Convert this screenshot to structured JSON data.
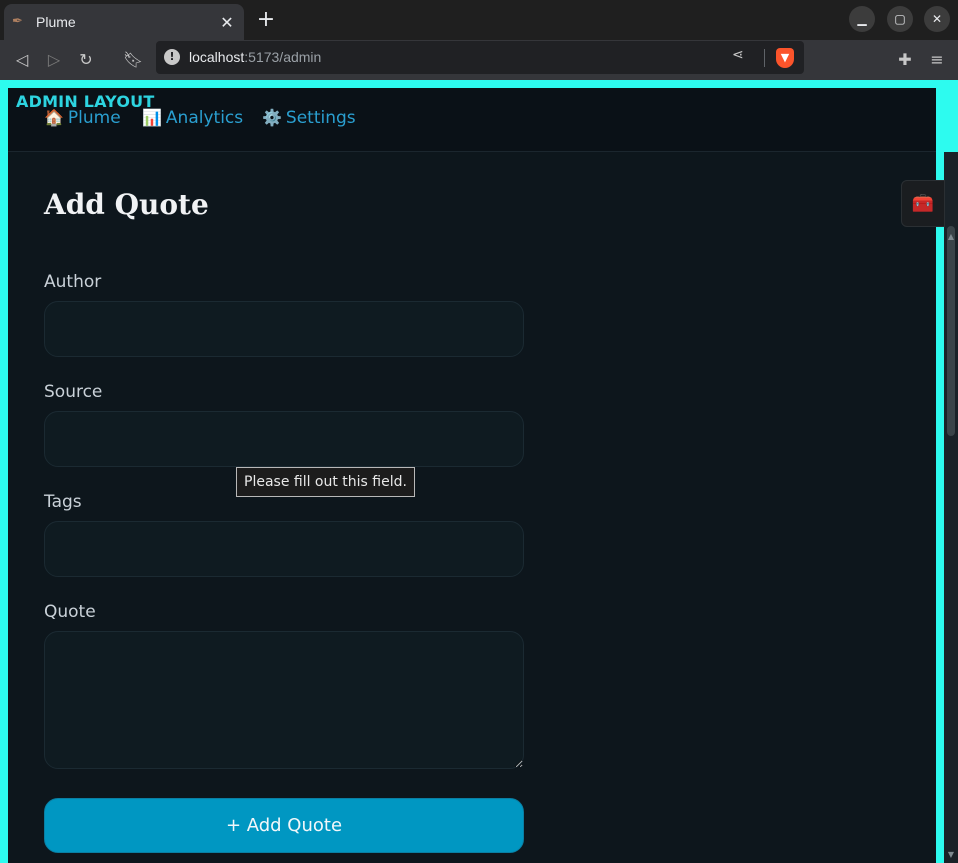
{
  "browser": {
    "tab_title": "Plume",
    "tab_favicon": "feather-icon",
    "new_tab_glyph": "+",
    "url_host": "localhost",
    "url_rest": ":5173/admin"
  },
  "app": {
    "admin_label": "ADMIN LAYOUT",
    "nav": [
      {
        "icon": "🏠",
        "label": "Plume"
      },
      {
        "icon": "📊",
        "label": "Analytics"
      },
      {
        "icon": "⚙️",
        "label": "Settings"
      }
    ],
    "page_title": "Add Quote",
    "form": {
      "author_label": "Author",
      "author_value": "",
      "source_label": "Source",
      "source_value": "",
      "tags_label": "Tags",
      "tags_value": "",
      "quote_label": "Quote",
      "quote_value": "",
      "submit_label": "+ Add Quote"
    },
    "validation_tooltip": "Please fill out this field.",
    "toolbox_icon": "🧰"
  },
  "colors": {
    "accent_border": "#2dfbef",
    "nav_link": "#2a9fd0",
    "button": "#0097c2",
    "background": "#0d161c"
  }
}
